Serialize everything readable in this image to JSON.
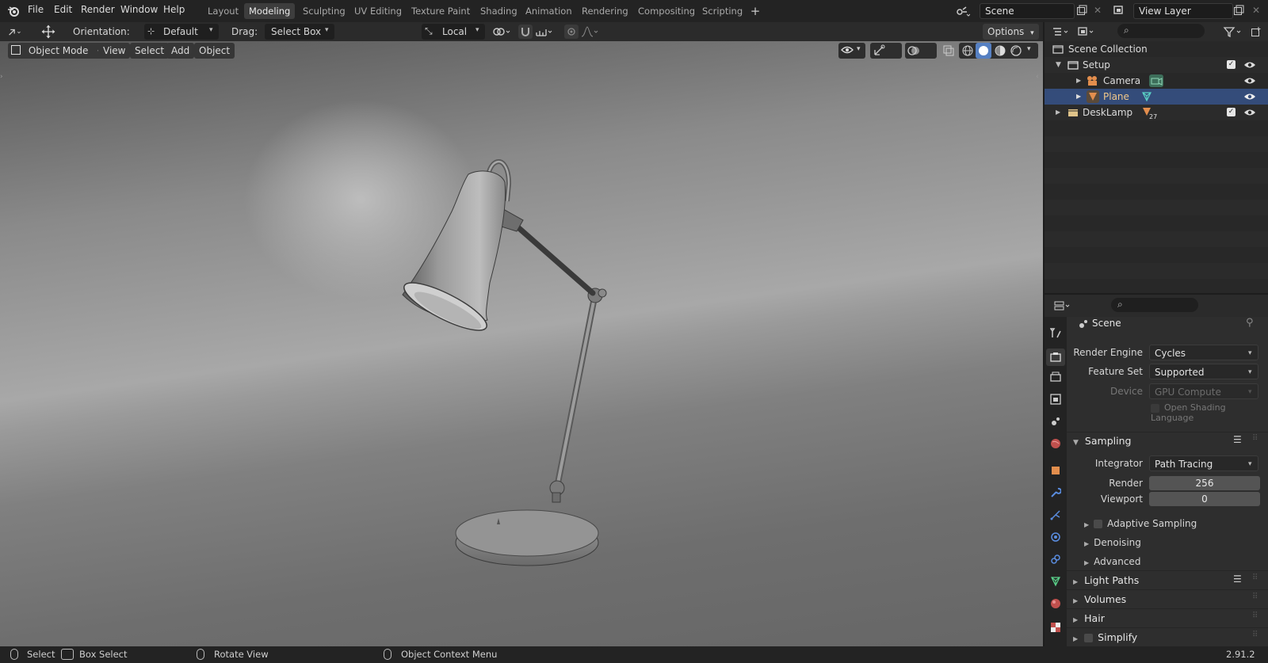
{
  "topbar": {
    "menus": [
      "File",
      "Edit",
      "Render",
      "Window",
      "Help"
    ],
    "workspaces": [
      "Layout",
      "Modeling",
      "Sculpting",
      "UV Editing",
      "Texture Paint",
      "Shading",
      "Animation",
      "Rendering",
      "Compositing",
      "Scripting"
    ],
    "active_workspace": "Modeling",
    "scene_name": "Scene",
    "view_layer": "View Layer"
  },
  "tool_header": {
    "orientation_label": "Orientation:",
    "orientation_value": "Default",
    "drag_label": "Drag:",
    "drag_value": "Select Box",
    "pivot_value": "Local",
    "options_label": "Options"
  },
  "viewport_header": {
    "mode": "Object Mode",
    "menus": [
      "View",
      "Select",
      "Add",
      "Object"
    ]
  },
  "outliner": {
    "root": "Scene Collection",
    "items": [
      {
        "label": "Setup",
        "type": "collection"
      },
      {
        "label": "Camera",
        "type": "camera"
      },
      {
        "label": "Plane",
        "type": "mesh"
      },
      {
        "label": "DeskLamp",
        "type": "collection",
        "badge": "27"
      }
    ]
  },
  "properties": {
    "context": "Scene",
    "render_engine_label": "Render Engine",
    "render_engine": "Cycles",
    "feature_set_label": "Feature Set",
    "feature_set": "Supported",
    "device_label": "Device",
    "device": "GPU Compute",
    "osl_label": "Open Shading Language",
    "sampling": {
      "title": "Sampling",
      "integrator_label": "Integrator",
      "integrator": "Path Tracing",
      "render_label": "Render",
      "render_value": "256",
      "viewport_label": "Viewport",
      "viewport_value": "0",
      "subpanels": [
        "Adaptive Sampling",
        "Denoising",
        "Advanced"
      ]
    },
    "panels": [
      "Light Paths",
      "Volumes",
      "Hair",
      "Simplify"
    ]
  },
  "statusbar": {
    "select": "Select",
    "box_select": "Box Select",
    "rotate_view": "Rotate View",
    "context_menu": "Object Context Menu",
    "version": "2.91.2"
  },
  "colors": {
    "selected_row": "#344c7a",
    "collection_icon": "#e0c48a",
    "camera_icon": "#e38e4d",
    "mesh_icon": "#e38e4d"
  }
}
